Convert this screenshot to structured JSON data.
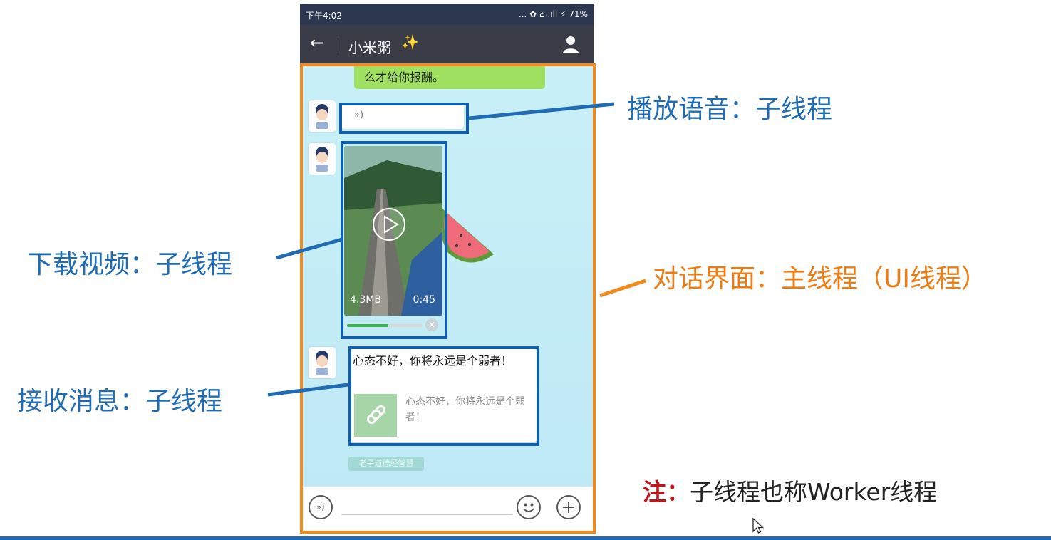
{
  "status_bar": {
    "time": "下午4:02",
    "icons": "... ✿ ⌂ .ıll ⚡ 71%"
  },
  "header": {
    "back_icon": "←",
    "title": "小米粥",
    "sparkle_icon": "✨"
  },
  "messages": {
    "sent_text": "么才给你报酬。",
    "voice_icon": "»)",
    "video": {
      "size": "4.3MB",
      "duration": "0:45",
      "progress_percent": 55
    },
    "link": {
      "title": "心态不好，你将永远是个弱者！",
      "desc": "心态不好，你将永远是个弱者！"
    },
    "timestamp": "老子道德经智慧"
  },
  "input_bar": {
    "voice_icon": "»)"
  },
  "annotations": {
    "play_voice": "播放语音：子线程",
    "download_video": "下载视频：子线程",
    "receive_message": "接收消息：子线程",
    "ui_thread": "对话界面：主线程（UI线程）",
    "note_label": "注：",
    "note_text": "子线程也称Worker线程"
  },
  "colors": {
    "blue": "#1f6cb5",
    "orange": "#f28a1d",
    "note_red": "#c0141b"
  }
}
